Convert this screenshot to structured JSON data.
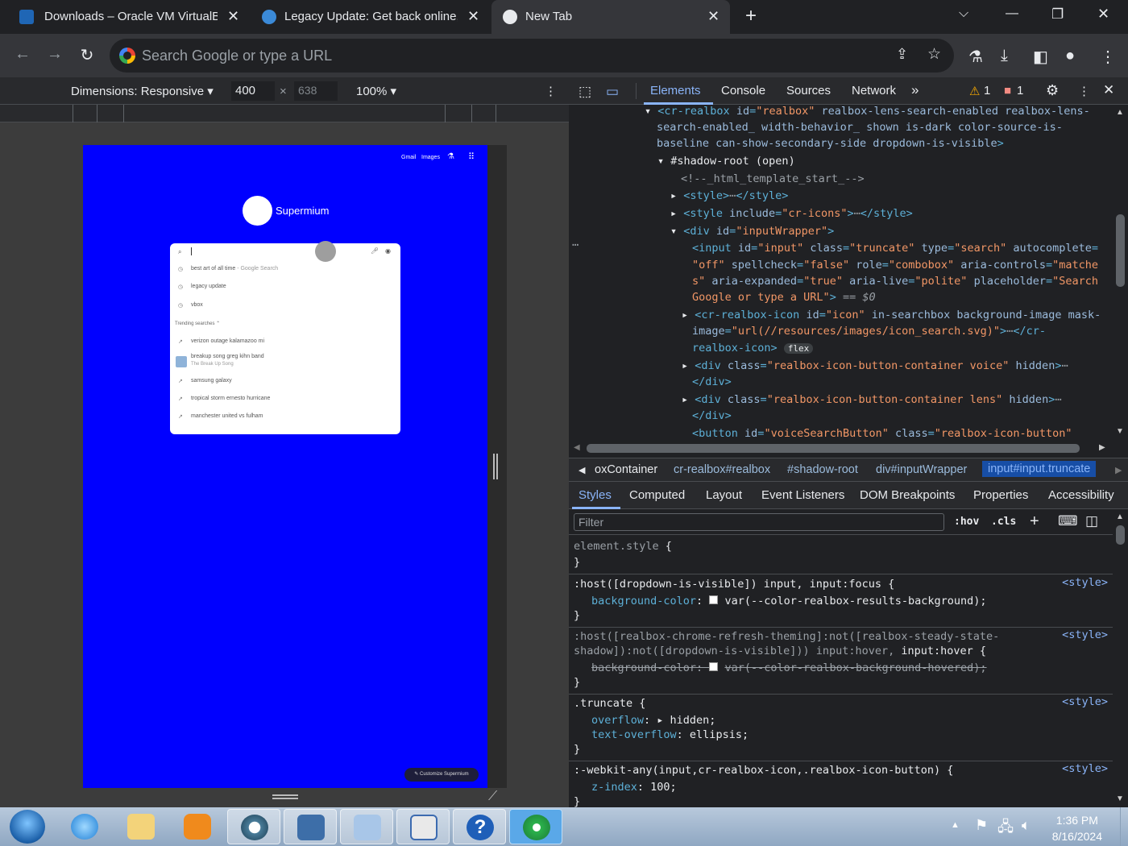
{
  "tabs": [
    {
      "title": "Downloads – Oracle VM VirtualB",
      "close": "✕"
    },
    {
      "title": "Legacy Update: Get back online,",
      "close": "✕"
    },
    {
      "title": "New Tab",
      "close": "✕"
    }
  ],
  "window_controls": {
    "new_tab": "+",
    "dropdown": "⌵",
    "minimize": "—",
    "maximize": "❐",
    "close": "✕"
  },
  "omnibox": {
    "placeholder": "Search Google or type a URL"
  },
  "device_toolbar": {
    "dimensions_label": "Dimensions: Responsive ▾",
    "width": "400",
    "times": "×",
    "height": "638",
    "zoom": "100% ▾"
  },
  "ntp": {
    "links": [
      "Gmail",
      "Images"
    ],
    "logo_text": "Supermium",
    "suggestions": [
      "best art of all time",
      "legacy update",
      "vbox"
    ],
    "suggestion_suffix": " - Google Search",
    "trending_header": "Trending searches",
    "trending": [
      {
        "text": "verizon outage kalamazoo mi"
      },
      {
        "text": "breakup song greg kihn band",
        "sub": "The Break Up Song"
      },
      {
        "text": "samsung galaxy"
      },
      {
        "text": "tropical storm ernesto hurricane"
      },
      {
        "text": "manchester united vs fulham"
      }
    ],
    "customize": "✎ Customize Supermium"
  },
  "devtools": {
    "tabs": [
      "Elements",
      "Console",
      "Sources",
      "Network",
      "»"
    ],
    "warnings": "1",
    "errors": "1",
    "breadcrumbs": [
      "oxContainer",
      "cr-realbox#realbox",
      "#shadow-root",
      "div#inputWrapper",
      "input#input.truncate"
    ],
    "style_tabs": [
      "Styles",
      "Computed",
      "Layout",
      "Event Listeners",
      "DOM Breakpoints",
      "Properties",
      "Accessibility"
    ],
    "filter_placeholder": "Filter",
    "hov": ":hov",
    "cls": ".cls",
    "flex_badge": "flex"
  },
  "taskbar": {
    "time": "1:36 PM",
    "date": "8/16/2024"
  }
}
